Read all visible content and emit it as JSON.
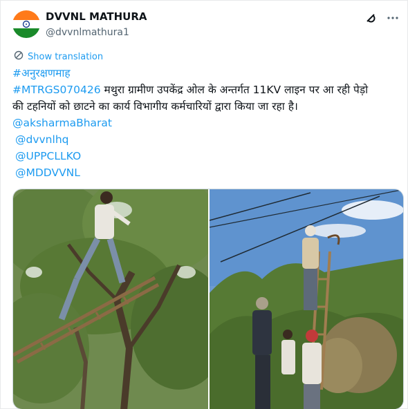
{
  "account": {
    "display_name": "DVVNL MATHURA",
    "handle": "@dvvnlmathura1"
  },
  "icons": {
    "grok": "grok-icon",
    "more": "more-icon",
    "translate": "translate-icon"
  },
  "translate_label": "Show translation",
  "post": {
    "hashtag1": "#अनुरक्षणमाह",
    "hashtag2": "#MTRGS070426",
    "body_line1": " मथुरा ग्रामीण उपकेंद्र ओल के अन्तर्गत 11KV लाइन पर आ रही पेड़ो",
    "body_line2": "की टहनियों को छाटने का कार्य विभागीय कर्मचारियों द्वारा किया जा रहा है।",
    "mentions": [
      "@aksharmaBharat",
      "@dvvnlhq",
      "@UPPCLLKO",
      "@MDDVVNL"
    ]
  },
  "colors": {
    "link": "#1d9bf0",
    "secondary": "#536471"
  }
}
